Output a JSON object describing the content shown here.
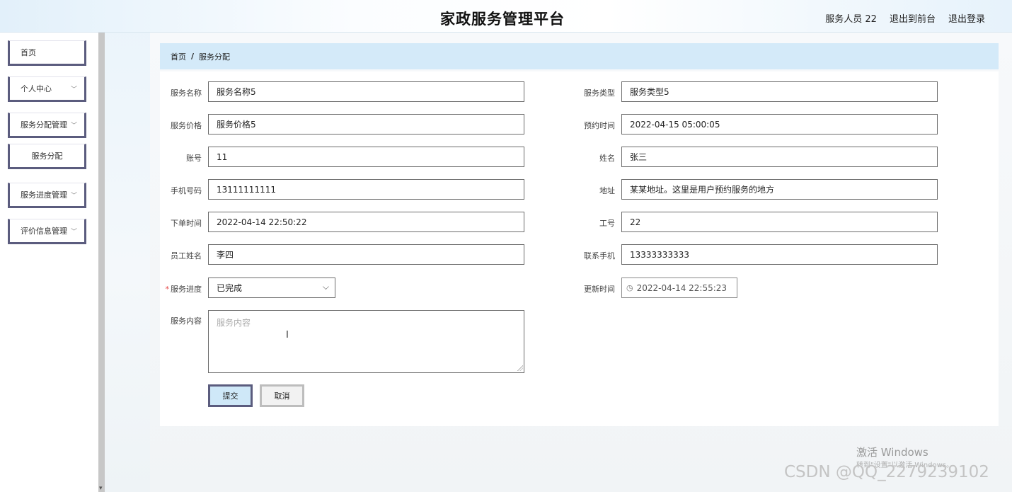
{
  "header": {
    "title": "家政服务管理平台",
    "user_label": "服务人员 22",
    "front_link": "退出到前台",
    "logout_link": "退出登录"
  },
  "sidebar": {
    "items": [
      {
        "label": "首页"
      },
      {
        "label": "个人中心"
      },
      {
        "label": "服务分配管理"
      },
      {
        "label": "服务分配"
      },
      {
        "label": "服务进度管理"
      },
      {
        "label": "评价信息管理"
      }
    ]
  },
  "breadcrumb": {
    "home": "首页",
    "separator": "/",
    "current": "服务分配"
  },
  "form": {
    "service_name": {
      "label": "服务名称",
      "value": "服务名称5"
    },
    "service_type": {
      "label": "服务类型",
      "value": "服务类型5"
    },
    "service_price": {
      "label": "服务价格",
      "value": "服务价格5"
    },
    "appointment_time": {
      "label": "预约时间",
      "value": "2022-04-15 05:00:05"
    },
    "account": {
      "label": "账号",
      "value": "11"
    },
    "name": {
      "label": "姓名",
      "value": "张三"
    },
    "phone": {
      "label": "手机号码",
      "value": "13111111111"
    },
    "address": {
      "label": "地址",
      "value": "某某地址。这里是用户预约服务的地方"
    },
    "order_time": {
      "label": "下单时间",
      "value": "2022-04-14 22:50:22"
    },
    "staff_no": {
      "label": "工号",
      "value": "22"
    },
    "staff_name": {
      "label": "员工姓名",
      "value": "李四"
    },
    "contact_phone": {
      "label": "联系手机",
      "value": "13333333333"
    },
    "progress": {
      "label": "服务进度",
      "required_mark": "*",
      "value": "已完成"
    },
    "update_time": {
      "label": "更新时间",
      "value": "2022-04-14 22:55:23"
    },
    "content": {
      "label": "服务内容",
      "placeholder": "服务内容"
    }
  },
  "buttons": {
    "submit": "提交",
    "cancel": "取消"
  },
  "watermark": {
    "activate_title": "激活 Windows",
    "activate_sub": "转到\"设置\"以激活 Windows。",
    "csdn": "CSDN @QQ_2279239102"
  }
}
